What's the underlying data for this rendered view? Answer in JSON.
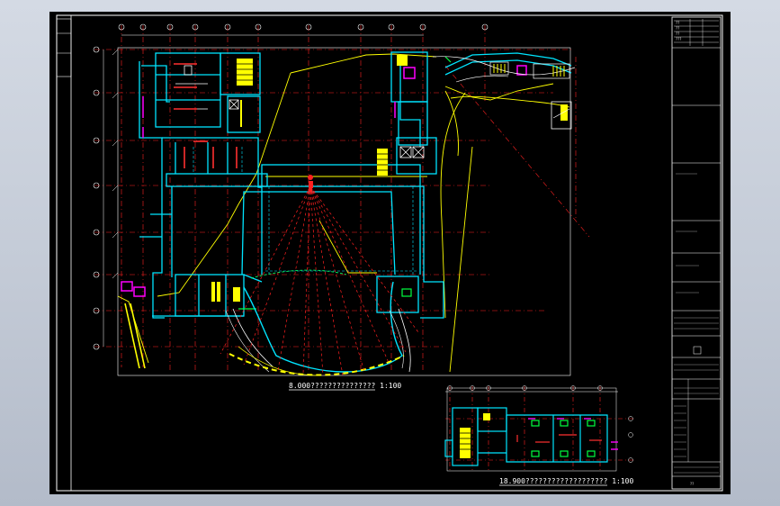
{
  "drawing": {
    "main_plan_caption": "8.000???????????????  1:100",
    "sub_plan_caption": "18.900???????????????????  1:100"
  },
  "title_block": {
    "stamp_lines": [
      "??",
      "??",
      "??",
      "???"
    ],
    "sheet_no": "??"
  },
  "colors": {
    "background": "#000000",
    "frame": "#ffffff",
    "axis": "#ff2020",
    "wall": "#00e5ff",
    "guide": "#ffff00",
    "accent": "#ff00ff"
  }
}
